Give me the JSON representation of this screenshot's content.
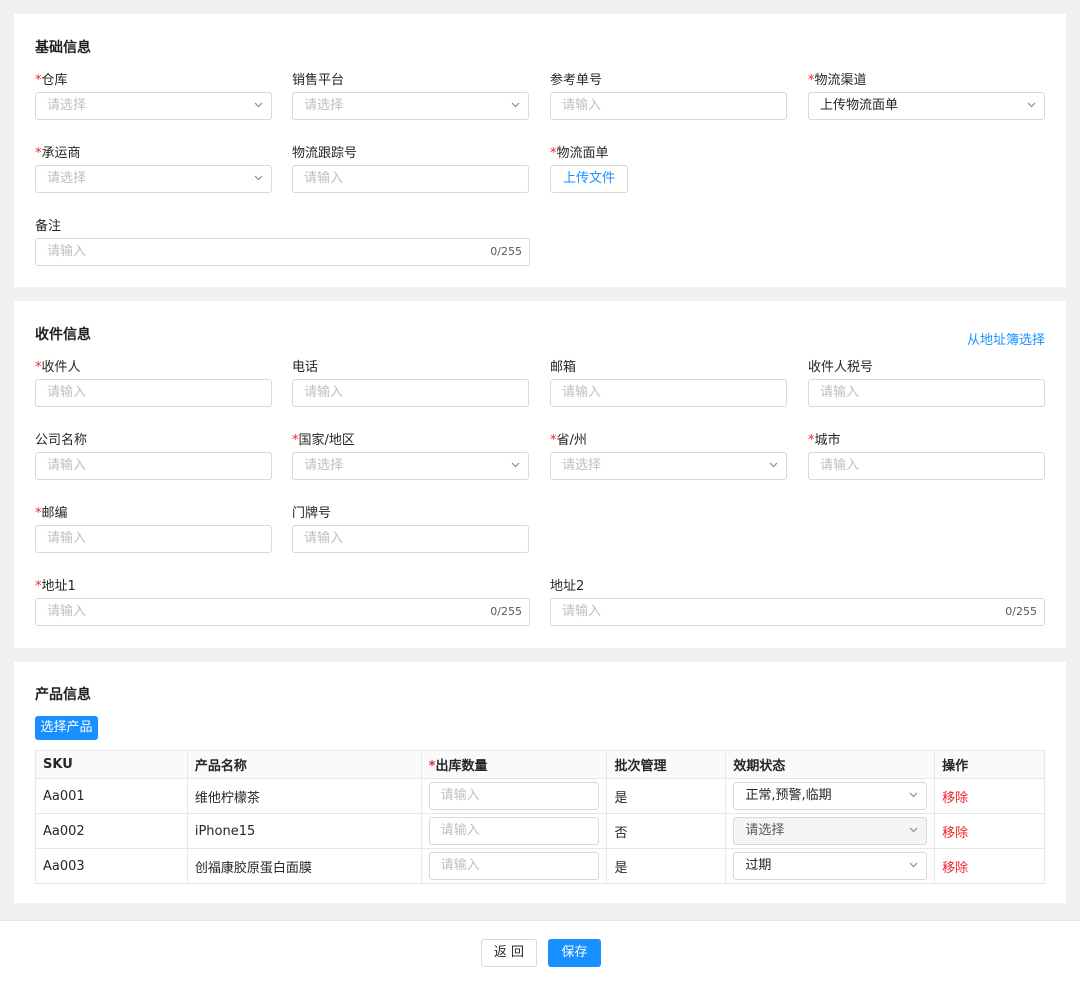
{
  "basic": {
    "title": "基础信息",
    "warehouse": {
      "label": "仓库",
      "placeholder": "请选择"
    },
    "platform": {
      "label": "销售平台",
      "placeholder": "请选择"
    },
    "ref_no": {
      "label": "参考单号",
      "placeholder": "请输入"
    },
    "channel": {
      "label": "物流渠道",
      "value": "上传物流面单"
    },
    "carrier": {
      "label": "承运商",
      "placeholder": "请选择"
    },
    "tracking": {
      "label": "物流跟踪号",
      "placeholder": "请输入"
    },
    "label_sheet": {
      "label": "物流面单",
      "button": "上传文件"
    },
    "remark": {
      "label": "备注",
      "placeholder": "请输入",
      "count": "0/255"
    }
  },
  "recipient": {
    "title": "收件信息",
    "address_book_link": "从地址簿选择",
    "name": {
      "label": "收件人",
      "placeholder": "请输入"
    },
    "phone": {
      "label": "电话",
      "placeholder": "请输入"
    },
    "email": {
      "label": "邮箱",
      "placeholder": "请输入"
    },
    "tax_no": {
      "label": "收件人税号",
      "placeholder": "请输入"
    },
    "company": {
      "label": "公司名称",
      "placeholder": "请输入"
    },
    "country": {
      "label": "国家/地区",
      "placeholder": "请选择"
    },
    "province": {
      "label": "省/州",
      "placeholder": "请选择"
    },
    "city": {
      "label": "城市",
      "placeholder": "请输入"
    },
    "postcode": {
      "label": "邮编",
      "placeholder": "请输入"
    },
    "door_no": {
      "label": "门牌号",
      "placeholder": "请输入"
    },
    "address1": {
      "label": "地址1",
      "placeholder": "请输入",
      "count": "0/255"
    },
    "address2": {
      "label": "地址2",
      "placeholder": "请输入",
      "count": "0/255"
    }
  },
  "products": {
    "title": "产品信息",
    "select_button": "选择产品",
    "columns": [
      "SKU",
      "产品名称",
      "出库数量",
      "批次管理",
      "效期状态",
      "操作"
    ],
    "rows": [
      {
        "sku": "Aa001",
        "name": "维他柠檬茶",
        "qty_placeholder": "请输入",
        "batch": "是",
        "expiry": "正常,预警,临期",
        "action": "移除"
      },
      {
        "sku": "Aa002",
        "name": "iPhone15",
        "qty_placeholder": "请输入",
        "batch": "否",
        "expiry": "请选择",
        "action": "移除"
      },
      {
        "sku": "Aa003",
        "name": "创福康胶原蛋白面膜",
        "qty_placeholder": "请输入",
        "batch": "是",
        "expiry": "过期",
        "action": "移除"
      }
    ]
  },
  "footer": {
    "back": "返 回",
    "save": "保存"
  }
}
